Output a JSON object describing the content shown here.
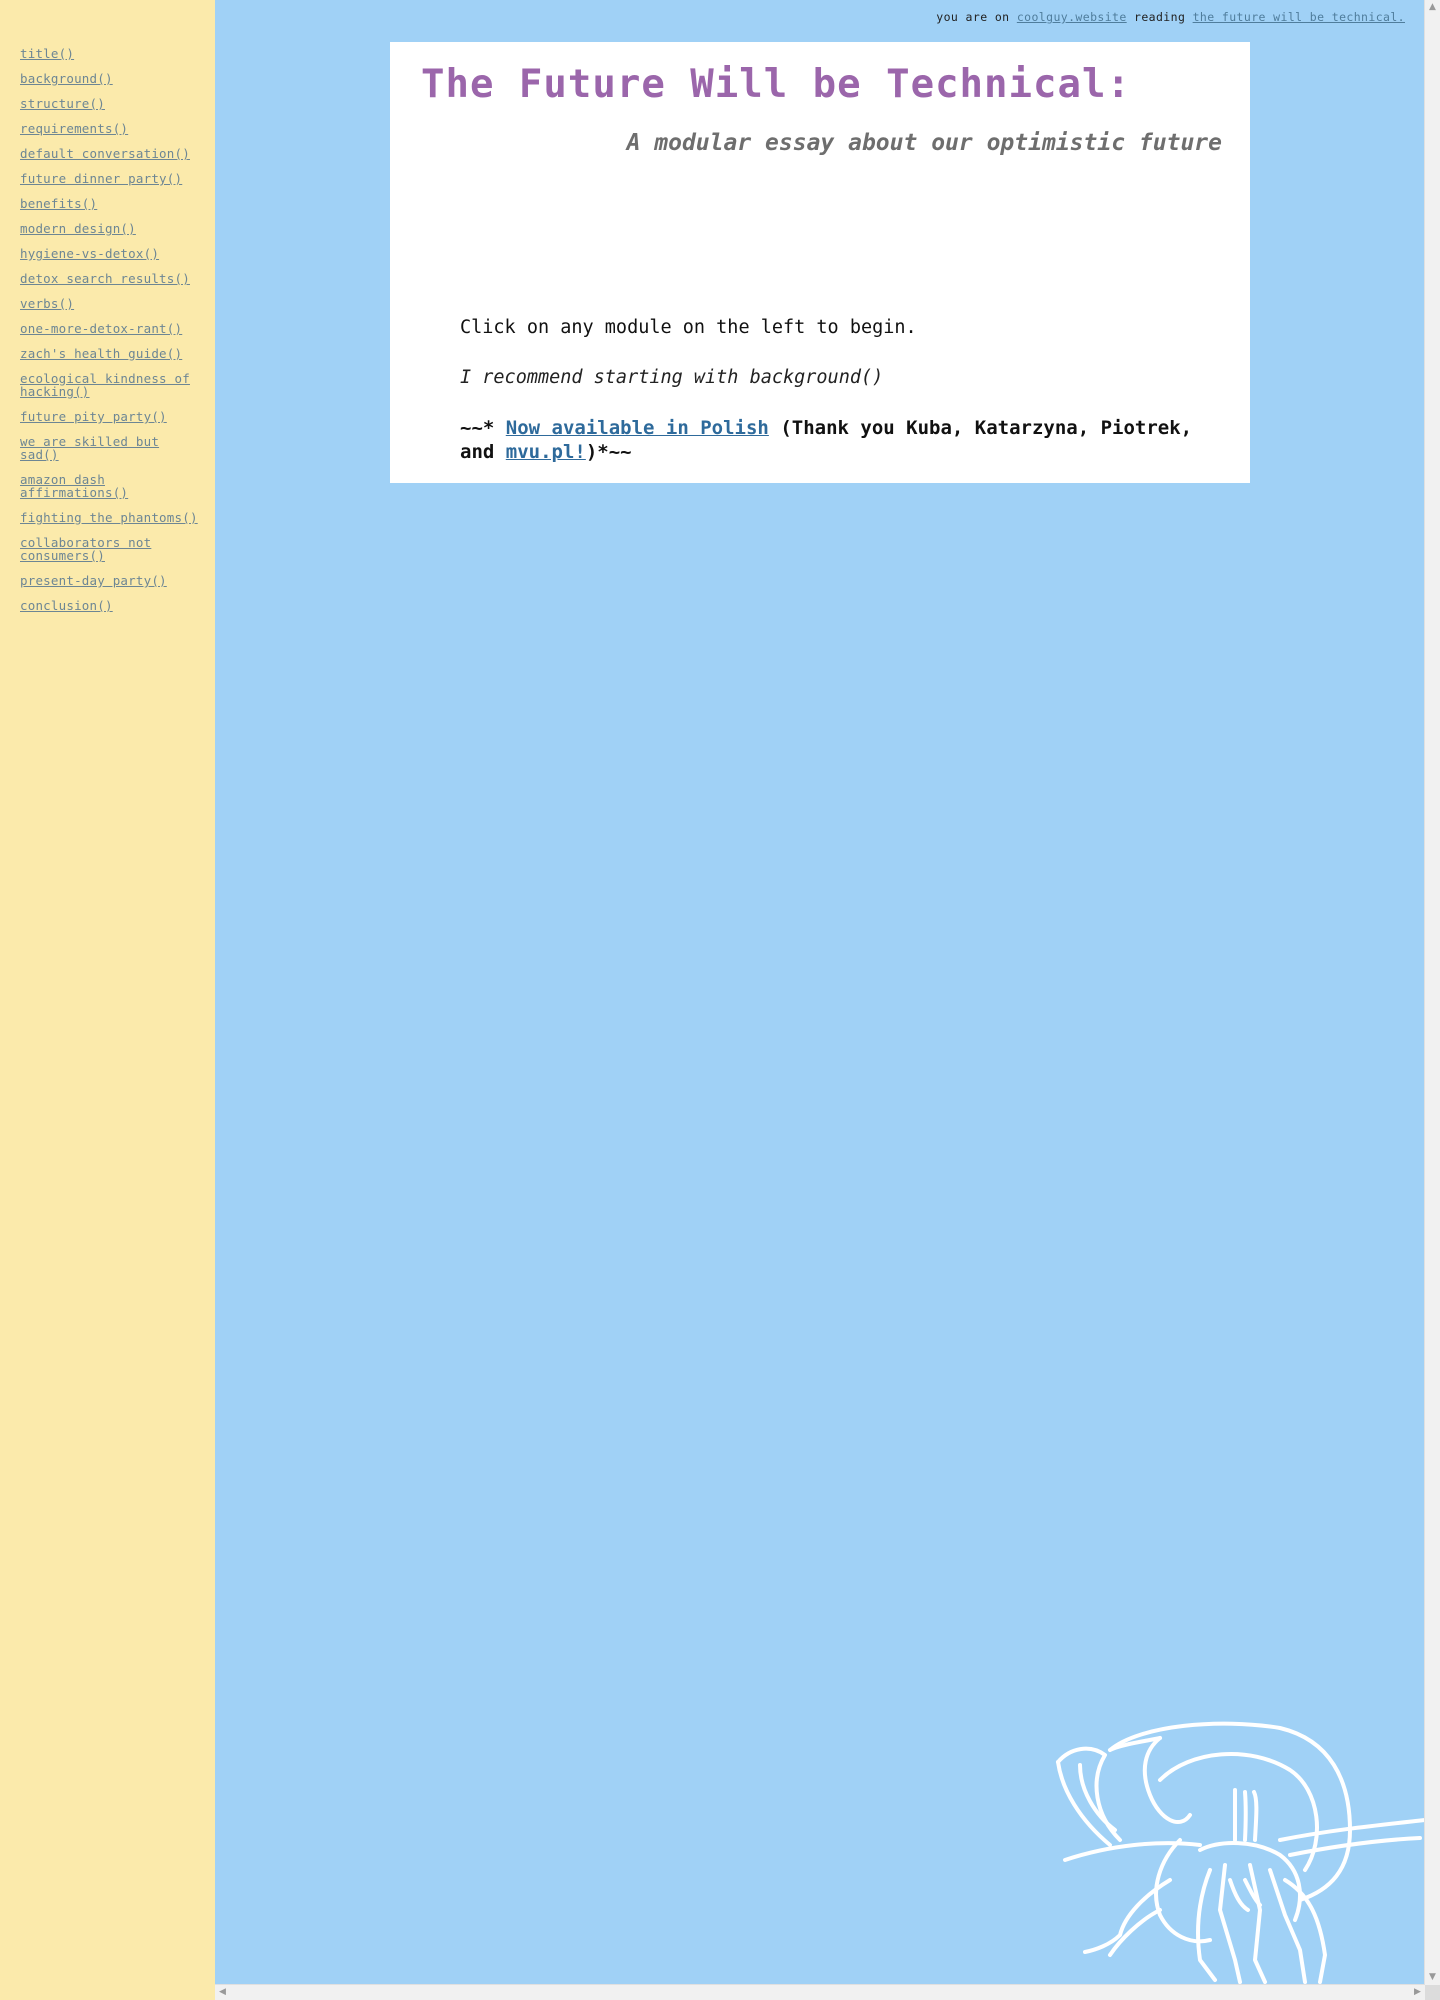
{
  "topbar": {
    "prefix": "you are on ",
    "site_link": "coolguy.website",
    "middle": " reading ",
    "page_link": "the future will be technical."
  },
  "sidebar": {
    "items": [
      {
        "label": "title()"
      },
      {
        "label": "background()"
      },
      {
        "label": "structure()"
      },
      {
        "label": "requirements()"
      },
      {
        "label": "default conversation()"
      },
      {
        "label": "future dinner party()"
      },
      {
        "label": "benefits()"
      },
      {
        "label": "modern design()"
      },
      {
        "label": "hygiene-vs-detox()"
      },
      {
        "label": "detox search results()"
      },
      {
        "label": "verbs()"
      },
      {
        "label": "one-more-detox-rant()"
      },
      {
        "label": "zach's health guide()"
      },
      {
        "label": "ecological kindness of hacking()"
      },
      {
        "label": "future pity party()"
      },
      {
        "label": "we are skilled but sad()"
      },
      {
        "label": "amazon dash affirmations()"
      },
      {
        "label": "fighting the phantoms()"
      },
      {
        "label": "collaborators not consumers()"
      },
      {
        "label": "present-day party()"
      },
      {
        "label": "conclusion()"
      }
    ]
  },
  "main": {
    "title": "The Future Will be Technical:",
    "subtitle": "A modular essay about our optimistic future",
    "intro": "Click on any module on the left to begin.",
    "recommend": "I recommend starting with background()",
    "polish_prefix": "~~* ",
    "polish_link": "Now available in Polish",
    "polish_middle": " (Thank you Kuba, Katarzyna, Piotrek, and ",
    "polish_link2": "mvu.pl!",
    "polish_suffix": ")*~~"
  },
  "colors": {
    "background": "#a0d1f6",
    "sidebar": "#fbeaab",
    "title": "#9b66ab",
    "link": "#2e6a9b"
  },
  "illustration": {
    "icon": "hermit-crab-illustration"
  }
}
